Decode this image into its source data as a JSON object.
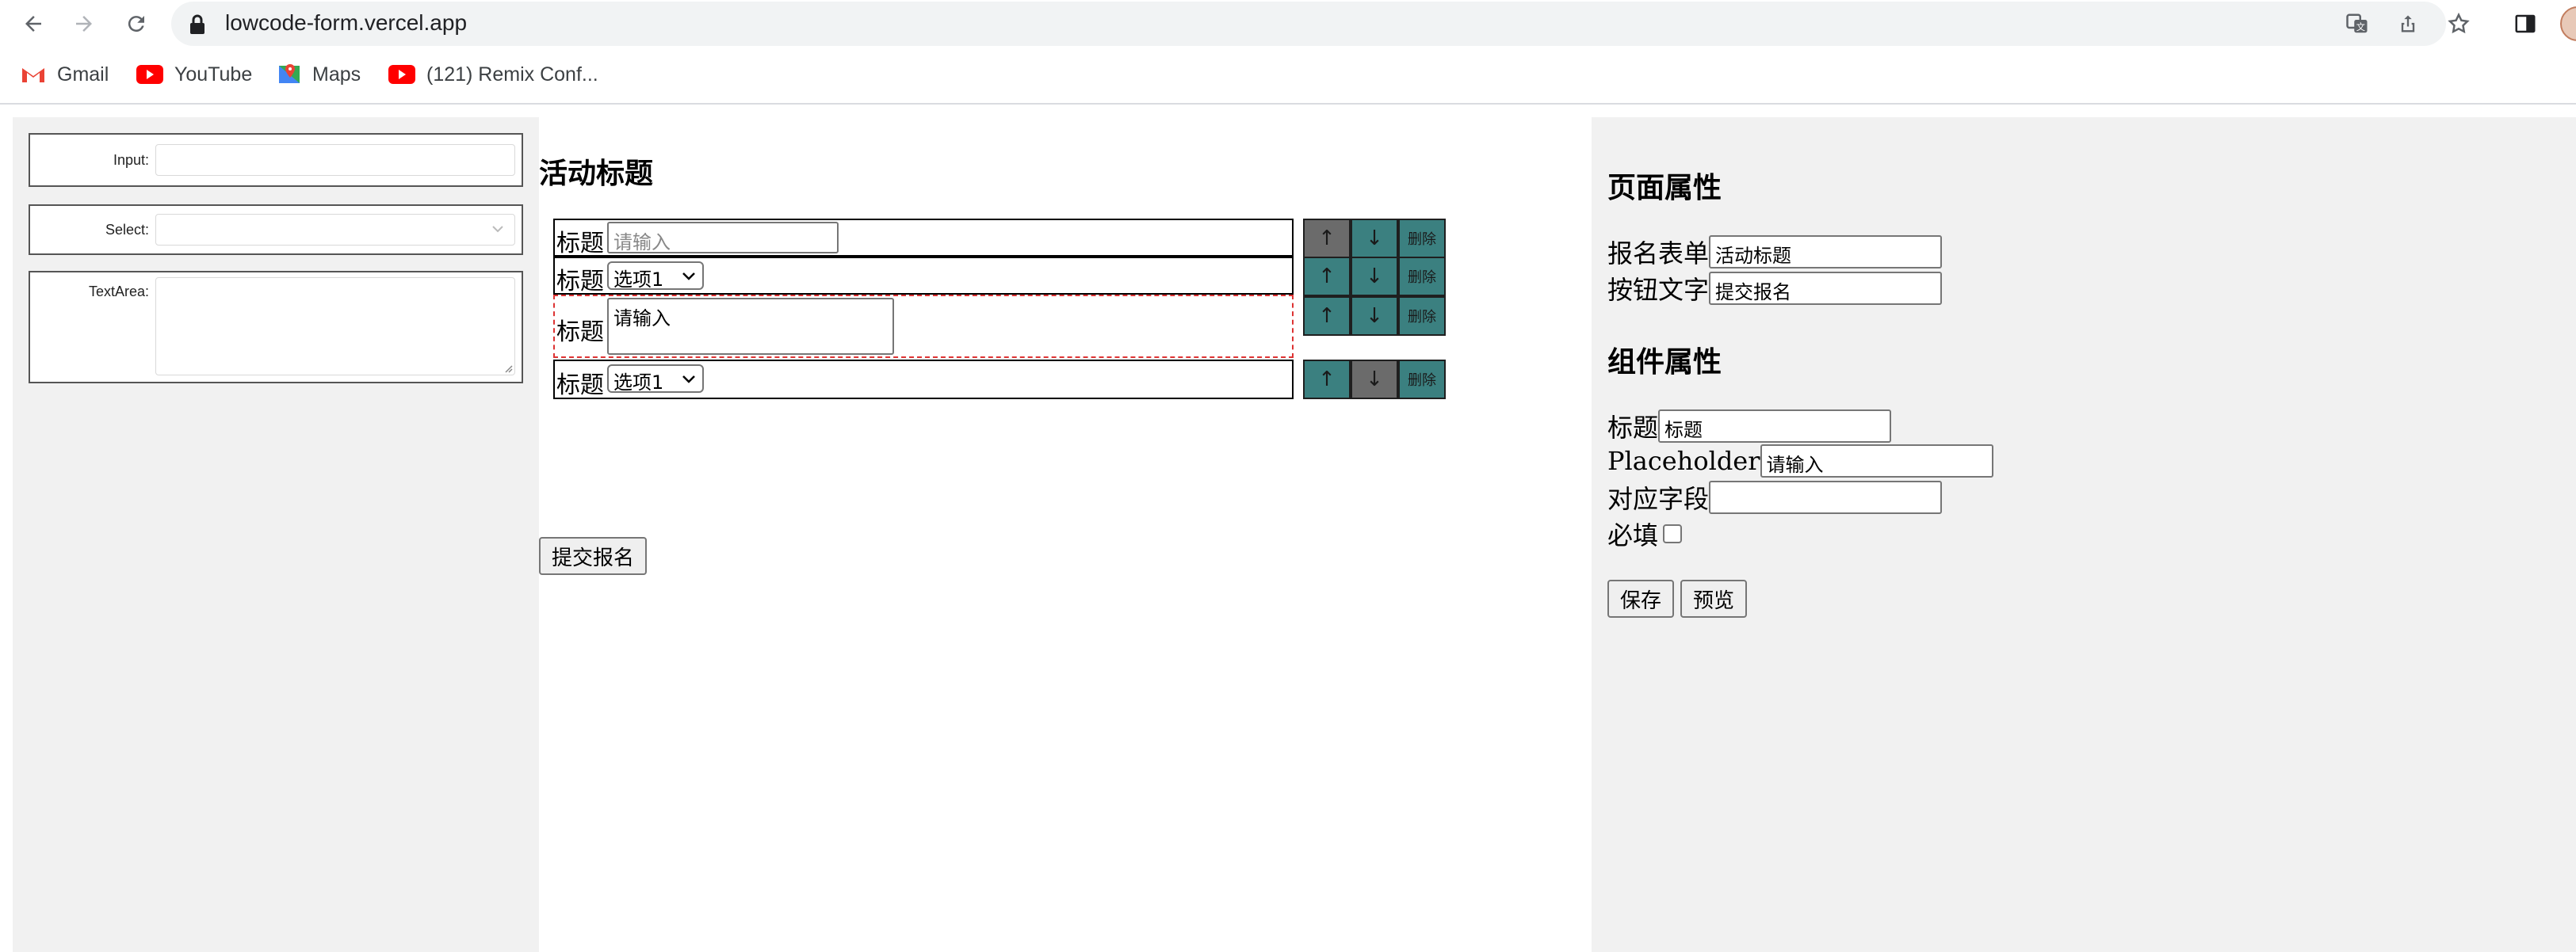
{
  "browser": {
    "url": "lowcode-form.vercel.app",
    "bookmarks": [
      {
        "label": "Gmail",
        "icon": "gmail-icon"
      },
      {
        "label": "YouTube",
        "icon": "youtube-icon"
      },
      {
        "label": "Maps",
        "icon": "maps-icon"
      },
      {
        "label": "(121) Remix Conf...",
        "icon": "youtube-icon"
      }
    ]
  },
  "components": {
    "input_label": "Input:",
    "select_label": "Select:",
    "textarea_label": "TextArea:"
  },
  "canvas": {
    "title": "活动标题",
    "rows": [
      {
        "label": "标题",
        "type": "input",
        "value": "请输入",
        "move_up_disabled": true,
        "move_down_disabled": false
      },
      {
        "label": "标题",
        "type": "select",
        "value": "选项1",
        "move_up_disabled": false,
        "move_down_disabled": false
      },
      {
        "label": "标题",
        "type": "textarea",
        "value": "请输入",
        "selected": true,
        "move_up_disabled": false,
        "move_down_disabled": false
      },
      {
        "label": "标题",
        "type": "select",
        "value": "选项1",
        "move_up_disabled": false,
        "move_down_disabled": true
      }
    ],
    "move_up": "↑",
    "move_down": "↓",
    "delete": "删除",
    "submit": "提交报名"
  },
  "properties": {
    "page_section": "页面属性",
    "form_label": "报名表单",
    "form_value": "活动标题",
    "button_text_label": "按钮文字",
    "button_text_value": "提交报名",
    "component_section": "组件属性",
    "title_label": "标题",
    "title_value": "标题",
    "placeholder_label": "Placeholder",
    "placeholder_value": "请输入",
    "field_label": "对应字段",
    "field_value": "",
    "required_label": "必填",
    "required_checked": false,
    "save": "保存",
    "preview": "预览"
  }
}
